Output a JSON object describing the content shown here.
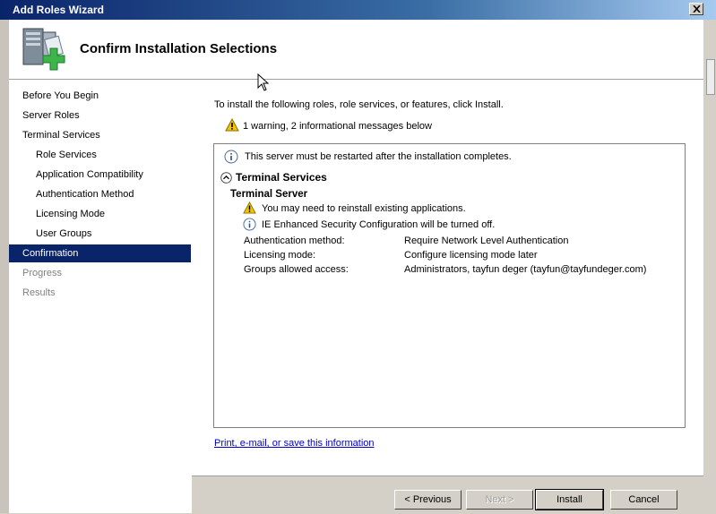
{
  "window": {
    "title": "Add Roles Wizard"
  },
  "header": {
    "title": "Confirm Installation Selections"
  },
  "nav": {
    "items": [
      {
        "label": "Before You Begin",
        "state": "normal"
      },
      {
        "label": "Server Roles",
        "state": "normal"
      },
      {
        "label": "Terminal Services",
        "state": "normal"
      },
      {
        "label": "Role Services",
        "state": "normal"
      },
      {
        "label": "Application Compatibility",
        "state": "normal"
      },
      {
        "label": "Authentication Method",
        "state": "normal"
      },
      {
        "label": "Licensing Mode",
        "state": "normal"
      },
      {
        "label": "User Groups",
        "state": "normal"
      },
      {
        "label": "Confirmation",
        "state": "active"
      },
      {
        "label": "Progress",
        "state": "disabled"
      },
      {
        "label": "Results",
        "state": "disabled"
      }
    ]
  },
  "content": {
    "intro": "To install the following roles, role services, or features, click Install.",
    "summary": "1 warning, 2 informational messages below",
    "restart_msg": "This server must be restarted after the installation completes.",
    "section_title": "Terminal Services",
    "subsection_title": "Terminal Server",
    "warning_msg": "You may need to reinstall existing applications.",
    "info_msg": "IE Enhanced Security Configuration will be turned off.",
    "details": [
      {
        "label": "Authentication method:",
        "value": "Require Network Level Authentication"
      },
      {
        "label": "Licensing mode:",
        "value": "Configure licensing mode later"
      },
      {
        "label": "Groups allowed access:",
        "value": "Administrators, tayfun deger (tayfun@tayfundeger.com)"
      }
    ],
    "link": "Print, e-mail, or save this information"
  },
  "buttons": {
    "previous": "< Previous",
    "next": "Next >",
    "install": "Install",
    "cancel": "Cancel"
  },
  "colors": {
    "selection": "#0a246a",
    "title_start": "#0a246a",
    "link": "#0000cc",
    "warning": "#f5c400"
  }
}
